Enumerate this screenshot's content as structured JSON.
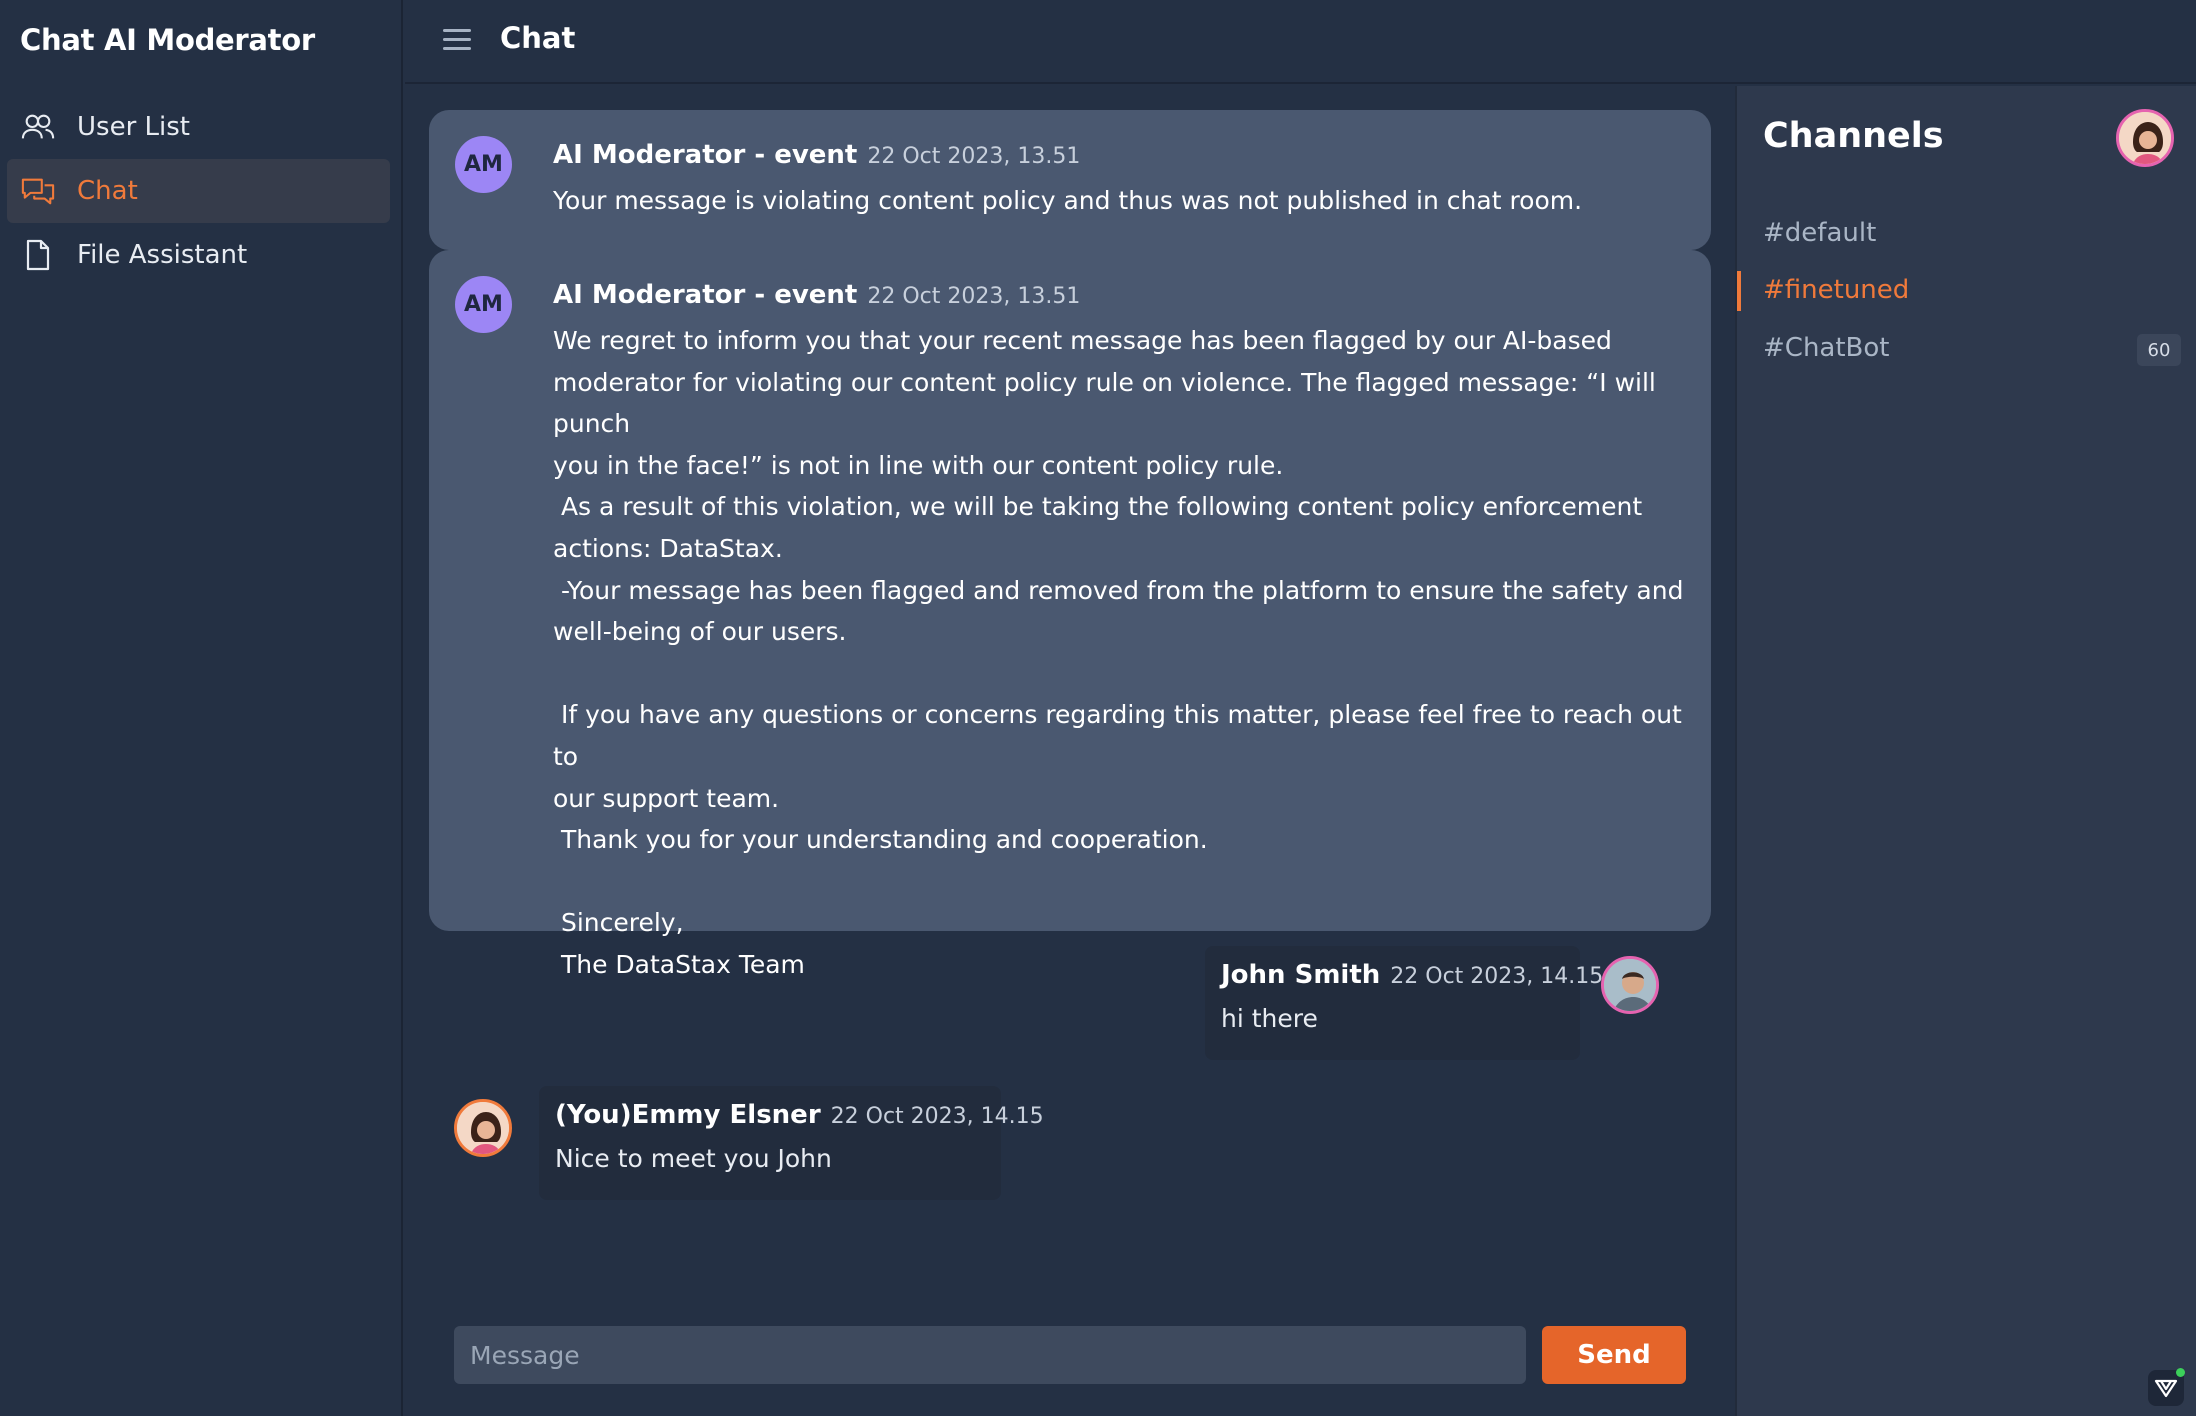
{
  "app": {
    "title": "Chat AI Moderator"
  },
  "sidebar": {
    "items": [
      {
        "label": "User List",
        "icon": "users-icon",
        "active": false
      },
      {
        "label": "Chat",
        "icon": "chat-icon",
        "active": true
      },
      {
        "label": "File Assistant",
        "icon": "file-icon",
        "active": false
      }
    ]
  },
  "header": {
    "title": "Chat"
  },
  "messages": [
    {
      "avatar_initials": "AM",
      "author": "AI Moderator - event",
      "time": "22 Oct 2023, 13.51",
      "body": "Your message is violating content policy and thus was not published in chat room."
    },
    {
      "avatar_initials": "AM",
      "author": "AI Moderator - event",
      "time": "22 Oct 2023, 13.51",
      "body": "We regret to inform you that your recent message has been flagged by our AI-based\nmoderator for violating our content policy rule on violence. The flagged message: “I will punch\nyou in the face!” is not in line with our content policy rule.\n As a result of this violation, we will be taking the following content policy enforcement\nactions: DataStax.\n -Your message has been flagged and removed from the platform to ensure the safety and\nwell-being of our users.\n\n If you have any questions or concerns regarding this matter, please feel free to reach out to\nour support team.\n Thank you for your understanding and cooperation.\n\n Sincerely,\n The DataStax Team"
    },
    {
      "author": "John Smith",
      "time": "22 Oct 2023, 14.15",
      "body": "hi there"
    },
    {
      "author": "(You)Emmy Elsner",
      "time": "22 Oct 2023, 14.15",
      "body": "Nice to meet you John"
    }
  ],
  "composer": {
    "placeholder": "Message",
    "send_label": "Send"
  },
  "channels": {
    "title": "Channels",
    "items": [
      {
        "label": "#default",
        "active": false,
        "badge": null
      },
      {
        "label": "#finetuned",
        "active": true,
        "badge": null
      },
      {
        "label": "#ChatBot",
        "active": false,
        "badge": "60"
      }
    ]
  },
  "colors": {
    "accent": "#f07a3b",
    "send": "#e5652a",
    "background": "#243044",
    "event_card": "#4a5870",
    "am_avatar": "#9c86f5"
  }
}
